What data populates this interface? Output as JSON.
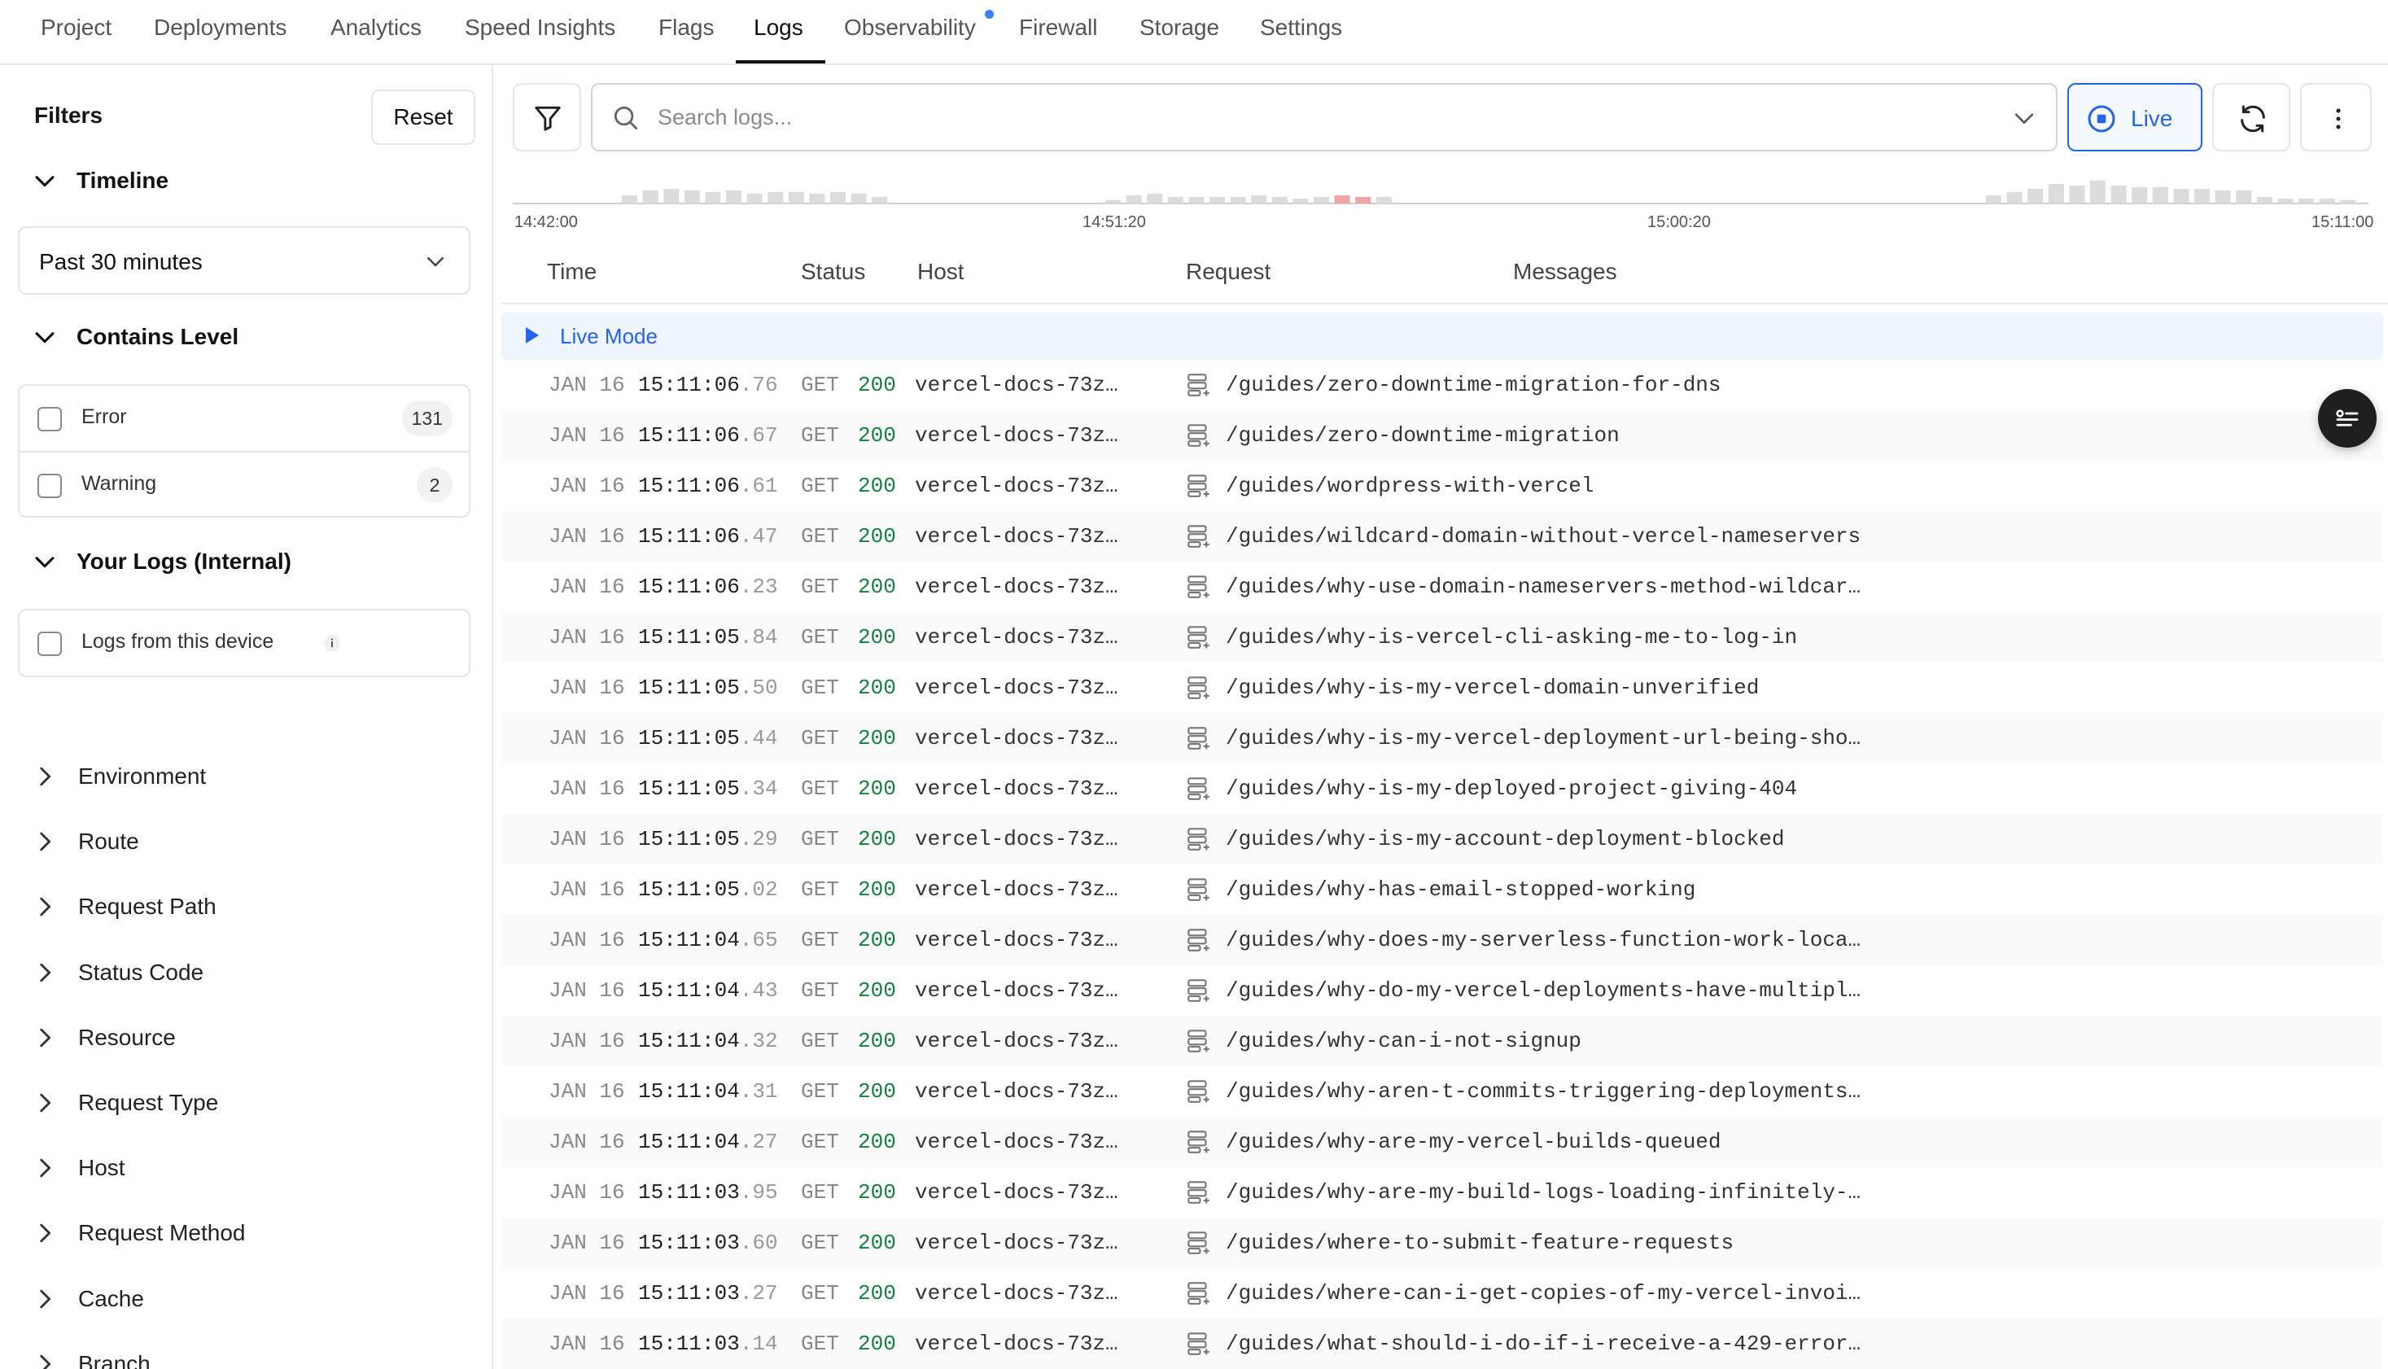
{
  "nav": {
    "tabs": [
      "Project",
      "Deployments",
      "Analytics",
      "Speed Insights",
      "Flags",
      "Logs",
      "Observability",
      "Firewall",
      "Storage",
      "Settings"
    ],
    "active_tab": "Logs"
  },
  "sidebar": {
    "title": "Filters",
    "reset_label": "Reset",
    "timeline": {
      "label": "Timeline",
      "selected": "Past 30 minutes"
    },
    "contains_level": {
      "label": "Contains Level",
      "options": [
        {
          "label": "Error",
          "count": "131"
        },
        {
          "label": "Warning",
          "count": "2"
        }
      ]
    },
    "your_logs": {
      "label": "Your Logs (Internal)",
      "option": "Logs from this device"
    },
    "collapsed_sections": [
      "Environment",
      "Route",
      "Request Path",
      "Status Code",
      "Resource",
      "Request Type",
      "Host",
      "Request Method",
      "Cache",
      "Branch"
    ]
  },
  "toolbar": {
    "search_placeholder": "Search logs...",
    "live_label": "Live"
  },
  "histogram": {
    "ticks": [
      "14:42:00",
      "14:51:20",
      "15:00:20",
      "15:11:00"
    ],
    "colors": {
      "info": "#dcdcdc",
      "error": "#f0a6a6"
    }
  },
  "table": {
    "columns": [
      "Time",
      "Status",
      "Host",
      "Request",
      "Messages"
    ],
    "live_mode_label": "Live Mode",
    "rows": [
      {
        "date": "JAN 16",
        "time": "15:11:06",
        "ms": ".76",
        "method": "GET",
        "status": "200",
        "host": "vercel-docs-73z…",
        "path": "/guides/zero-downtime-migration-for-dns"
      },
      {
        "date": "JAN 16",
        "time": "15:11:06",
        "ms": ".67",
        "method": "GET",
        "status": "200",
        "host": "vercel-docs-73z…",
        "path": "/guides/zero-downtime-migration"
      },
      {
        "date": "JAN 16",
        "time": "15:11:06",
        "ms": ".61",
        "method": "GET",
        "status": "200",
        "host": "vercel-docs-73z…",
        "path": "/guides/wordpress-with-vercel"
      },
      {
        "date": "JAN 16",
        "time": "15:11:06",
        "ms": ".47",
        "method": "GET",
        "status": "200",
        "host": "vercel-docs-73z…",
        "path": "/guides/wildcard-domain-without-vercel-nameservers"
      },
      {
        "date": "JAN 16",
        "time": "15:11:06",
        "ms": ".23",
        "method": "GET",
        "status": "200",
        "host": "vercel-docs-73z…",
        "path": "/guides/why-use-domain-nameservers-method-wildcar…"
      },
      {
        "date": "JAN 16",
        "time": "15:11:05",
        "ms": ".84",
        "method": "GET",
        "status": "200",
        "host": "vercel-docs-73z…",
        "path": "/guides/why-is-vercel-cli-asking-me-to-log-in"
      },
      {
        "date": "JAN 16",
        "time": "15:11:05",
        "ms": ".50",
        "method": "GET",
        "status": "200",
        "host": "vercel-docs-73z…",
        "path": "/guides/why-is-my-vercel-domain-unverified"
      },
      {
        "date": "JAN 16",
        "time": "15:11:05",
        "ms": ".44",
        "method": "GET",
        "status": "200",
        "host": "vercel-docs-73z…",
        "path": "/guides/why-is-my-vercel-deployment-url-being-sho…"
      },
      {
        "date": "JAN 16",
        "time": "15:11:05",
        "ms": ".34",
        "method": "GET",
        "status": "200",
        "host": "vercel-docs-73z…",
        "path": "/guides/why-is-my-deployed-project-giving-404"
      },
      {
        "date": "JAN 16",
        "time": "15:11:05",
        "ms": ".29",
        "method": "GET",
        "status": "200",
        "host": "vercel-docs-73z…",
        "path": "/guides/why-is-my-account-deployment-blocked"
      },
      {
        "date": "JAN 16",
        "time": "15:11:05",
        "ms": ".02",
        "method": "GET",
        "status": "200",
        "host": "vercel-docs-73z…",
        "path": "/guides/why-has-email-stopped-working"
      },
      {
        "date": "JAN 16",
        "time": "15:11:04",
        "ms": ".65",
        "method": "GET",
        "status": "200",
        "host": "vercel-docs-73z…",
        "path": "/guides/why-does-my-serverless-function-work-loca…"
      },
      {
        "date": "JAN 16",
        "time": "15:11:04",
        "ms": ".43",
        "method": "GET",
        "status": "200",
        "host": "vercel-docs-73z…",
        "path": "/guides/why-do-my-vercel-deployments-have-multipl…"
      },
      {
        "date": "JAN 16",
        "time": "15:11:04",
        "ms": ".32",
        "method": "GET",
        "status": "200",
        "host": "vercel-docs-73z…",
        "path": "/guides/why-can-i-not-signup"
      },
      {
        "date": "JAN 16",
        "time": "15:11:04",
        "ms": ".31",
        "method": "GET",
        "status": "200",
        "host": "vercel-docs-73z…",
        "path": "/guides/why-aren-t-commits-triggering-deployments…"
      },
      {
        "date": "JAN 16",
        "time": "15:11:04",
        "ms": ".27",
        "method": "GET",
        "status": "200",
        "host": "vercel-docs-73z…",
        "path": "/guides/why-are-my-vercel-builds-queued"
      },
      {
        "date": "JAN 16",
        "time": "15:11:03",
        "ms": ".95",
        "method": "GET",
        "status": "200",
        "host": "vercel-docs-73z…",
        "path": "/guides/why-are-my-build-logs-loading-infinitely-…"
      },
      {
        "date": "JAN 16",
        "time": "15:11:03",
        "ms": ".60",
        "method": "GET",
        "status": "200",
        "host": "vercel-docs-73z…",
        "path": "/guides/where-to-submit-feature-requests"
      },
      {
        "date": "JAN 16",
        "time": "15:11:03",
        "ms": ".27",
        "method": "GET",
        "status": "200",
        "host": "vercel-docs-73z…",
        "path": "/guides/where-can-i-get-copies-of-my-vercel-invoi…"
      },
      {
        "date": "JAN 16",
        "time": "15:11:03",
        "ms": ".14",
        "method": "GET",
        "status": "200",
        "host": "vercel-docs-73z…",
        "path": "/guides/what-should-i-do-if-i-receive-a-429-error…"
      }
    ]
  }
}
